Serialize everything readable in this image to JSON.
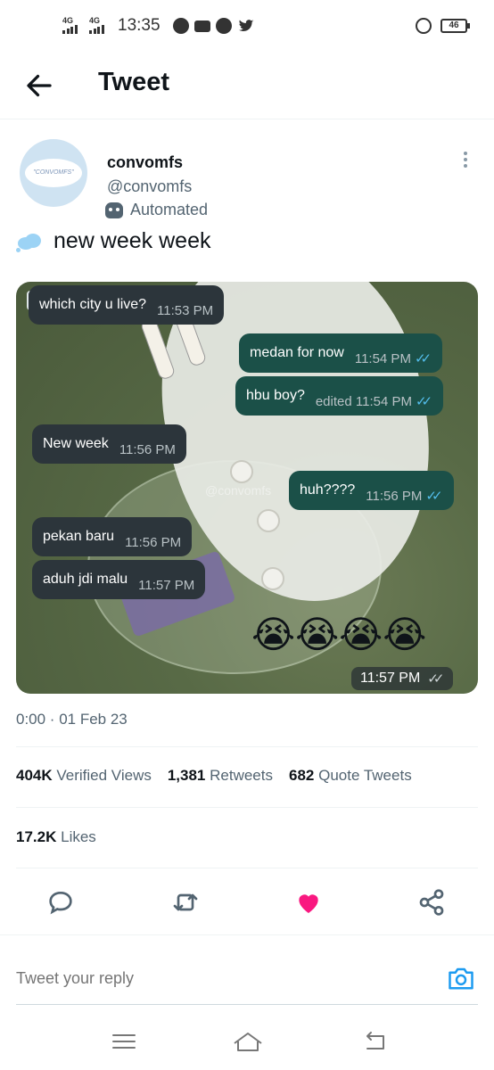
{
  "status_bar": {
    "signal1": "4G",
    "signal2": "4G",
    "time": "13:35",
    "battery": "46"
  },
  "header": {
    "title": "Tweet"
  },
  "author": {
    "name": "convomfs",
    "handle": "@convomfs",
    "automated_label": "Automated",
    "avatar_text": "\"CONVOMFS\""
  },
  "tweet": {
    "text": "new week week",
    "timestamp": "0:00 · 01 Feb 23"
  },
  "chat": {
    "watermark": "@convomfs",
    "messages": [
      {
        "dir": "in",
        "text": "which city u live?",
        "time": "11:53 PM"
      },
      {
        "dir": "out",
        "text": "medan for now",
        "time": "11:54 PM"
      },
      {
        "dir": "out",
        "text": "hbu boy?",
        "time": "edited 11:54 PM"
      },
      {
        "dir": "in",
        "text": "New week",
        "time": "11:56 PM"
      },
      {
        "dir": "out",
        "text": "huh????",
        "time": "11:56 PM"
      },
      {
        "dir": "in",
        "text": "pekan baru",
        "time": "11:56 PM"
      },
      {
        "dir": "in",
        "text": "aduh jdi malu",
        "time": "11:57 PM"
      }
    ],
    "emojis": "😭😭😭😭",
    "last_time": "11:57 PM"
  },
  "stats": {
    "views_count": "404K",
    "views_label": "Verified Views",
    "retweets_count": "1,381",
    "retweets_label": "Retweets",
    "quotes_count": "682",
    "quotes_label": "Quote Tweets",
    "likes_count": "17.2K",
    "likes_label": "Likes"
  },
  "reply": {
    "placeholder": "Tweet your reply"
  },
  "colors": {
    "like_active": "#f91880",
    "camera_blue": "#1d9bf0",
    "bubble_in": "#2c353b",
    "bubble_out": "#1b5048"
  }
}
